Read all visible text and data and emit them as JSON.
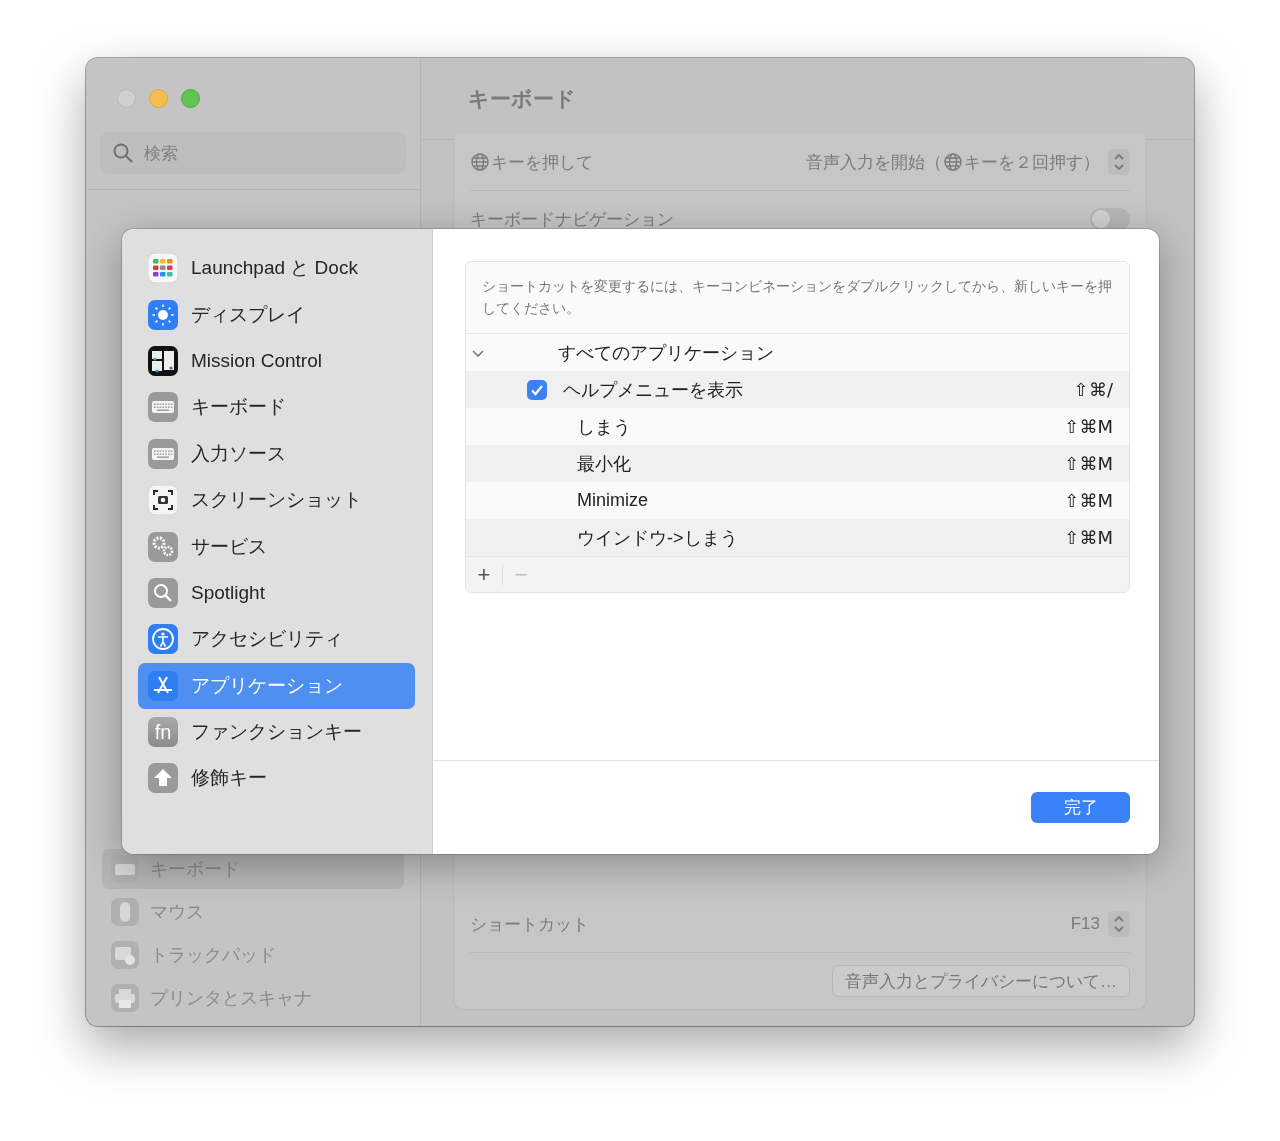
{
  "window": {
    "title": "キーボード"
  },
  "sidebar": {
    "search": {
      "placeholder": "検索"
    },
    "items": [
      {
        "label": "キーボード",
        "selected": true
      },
      {
        "label": "マウス",
        "selected": false
      },
      {
        "label": "トラックパッド",
        "selected": false
      },
      {
        "label": "プリンタとスキャナ",
        "selected": false
      }
    ]
  },
  "settings": {
    "top_rows": [
      {
        "kind": "globe_select",
        "label": "キーを押して",
        "value": [
          "音声入力を開始（",
          "キーを２回押す）"
        ]
      },
      {
        "kind": "toggle",
        "label": "キーボードナビゲーション",
        "on": false
      }
    ],
    "bottom_rows": [
      {
        "kind": "select",
        "label": "ショートカット",
        "value": [
          "F13"
        ]
      },
      {
        "kind": "button",
        "label": "音声入力とプライバシーについて…"
      }
    ]
  },
  "sheet": {
    "categories": [
      {
        "label": "Launchpad と Dock",
        "selected": false
      },
      {
        "label": "ディスプレイ",
        "selected": false
      },
      {
        "label": "Mission Control",
        "selected": false
      },
      {
        "label": "キーボード",
        "selected": false
      },
      {
        "label": "入力ソース",
        "selected": false
      },
      {
        "label": "スクリーンショット",
        "selected": false
      },
      {
        "label": "サービス",
        "selected": false
      },
      {
        "label": "Spotlight",
        "selected": false
      },
      {
        "label": "アクセシビリティ",
        "selected": false
      },
      {
        "label": "アプリケーション",
        "selected": true
      },
      {
        "icon_text": "fn",
        "label": "ファンクションキー",
        "selected": false
      },
      {
        "label": "修飾キー",
        "selected": false
      }
    ],
    "help": "ショートカットを変更するには、キーコンビネーションをダブルクリックしてから、新しいキーを押してください。",
    "group": {
      "label": "すべてのアプリケーション",
      "expanded": true
    },
    "shortcuts": [
      {
        "kind": "checkbox",
        "checked": true,
        "label": "ヘルプメニューを表示",
        "keys": "⇧⌘/"
      },
      {
        "kind": "plain",
        "label": "しまう",
        "keys": "⇧⌘M"
      },
      {
        "kind": "plain",
        "label": "最小化",
        "keys": "⇧⌘M"
      },
      {
        "kind": "plain",
        "label": "Minimize",
        "keys": "⇧⌘M"
      },
      {
        "kind": "plain",
        "label": "ウインドウ->しまう",
        "keys": "⇧⌘M"
      }
    ],
    "add": "+",
    "remove": "−",
    "done": "完了"
  }
}
